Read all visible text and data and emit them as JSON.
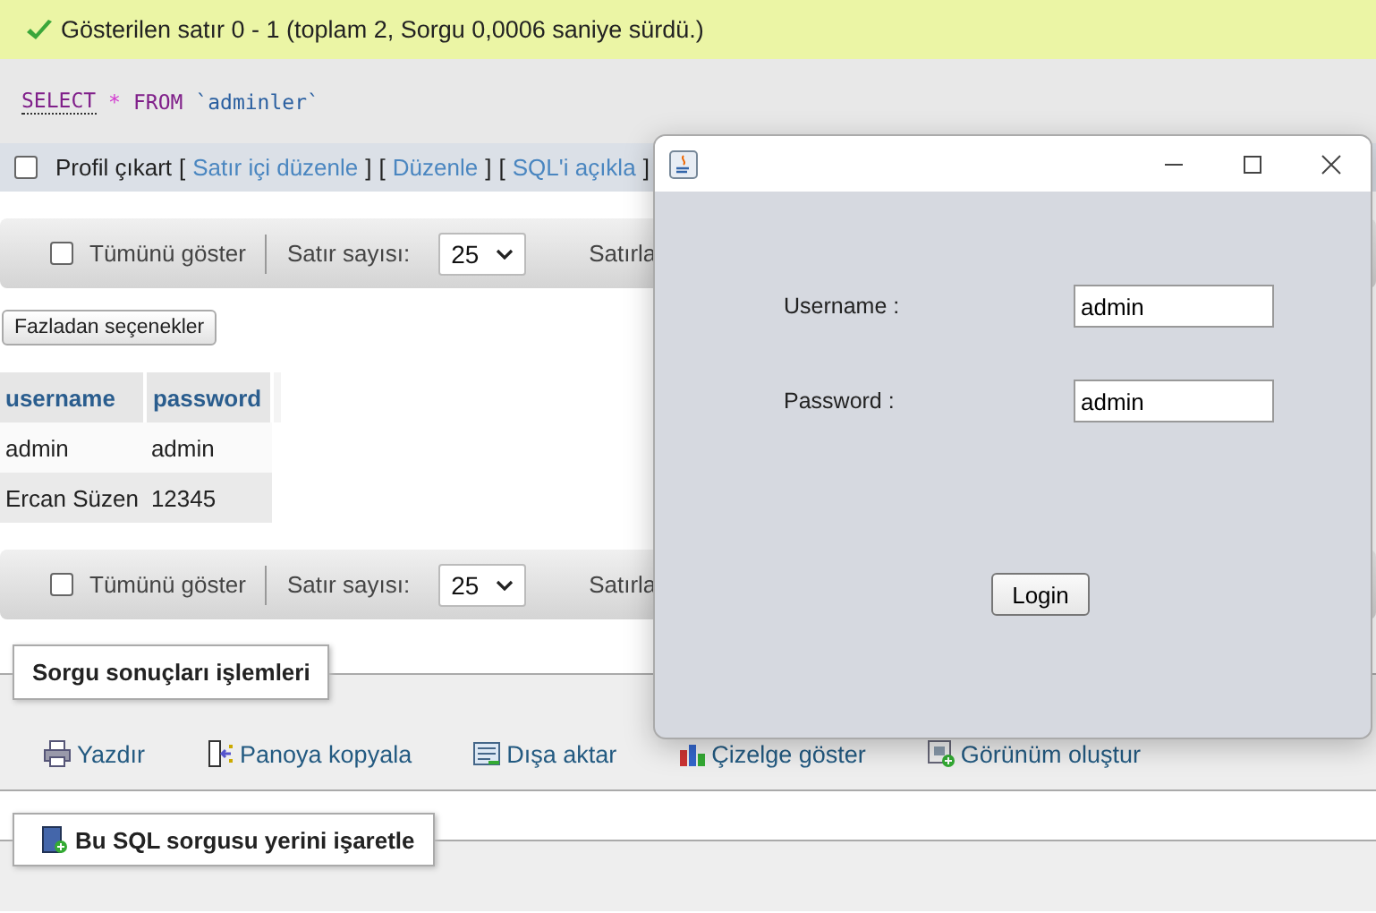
{
  "message": {
    "text": "Gösterilen satır 0 - 1 (toplam 2, Sorgu 0,0006 saniye sürdü.)"
  },
  "sql": {
    "keyword": "SELECT",
    "star": "*",
    "from": "FROM",
    "table": "`adminler`"
  },
  "profile_bar": {
    "checked": false,
    "label": "Profil çıkart",
    "bracket_open": "[",
    "bracket_close": "]",
    "links": [
      "Satır içi düzenle",
      "Düzenle",
      "SQL'i açıkla"
    ]
  },
  "nav_bars": [
    {
      "show_all": "Tümünü göster",
      "checked": false,
      "rows_label": "Satır sayısı:",
      "rows_value": "25",
      "cut_label": "Satırla"
    },
    {
      "show_all": "Tümünü göster",
      "checked": false,
      "rows_label": "Satır sayısı:",
      "rows_value": "25",
      "cut_label": "Satırla"
    }
  ],
  "extra_button": "Fazladan seçenekler",
  "table": {
    "columns": [
      "username",
      "password"
    ],
    "rows": [
      [
        "admin",
        "admin"
      ],
      [
        "Ercan Süzen",
        "12345"
      ]
    ]
  },
  "operations": {
    "title": "Sorgu sonuçları işlemleri",
    "items": [
      {
        "label": "Yazdır",
        "kind": "print"
      },
      {
        "label": "Panoya kopyala",
        "kind": "copy"
      },
      {
        "label": "Dışa aktar",
        "kind": "export"
      },
      {
        "label": "Çizelge göster",
        "kind": "chart"
      },
      {
        "label": "Görünüm oluştur",
        "kind": "view"
      }
    ]
  },
  "bookmark": {
    "title": "Bu SQL sorgusu yerini işaretle"
  },
  "dialog": {
    "fields": [
      {
        "label": "Username :",
        "value": "admin"
      },
      {
        "label": "Password :",
        "value": "admin"
      }
    ],
    "button": "Login"
  }
}
